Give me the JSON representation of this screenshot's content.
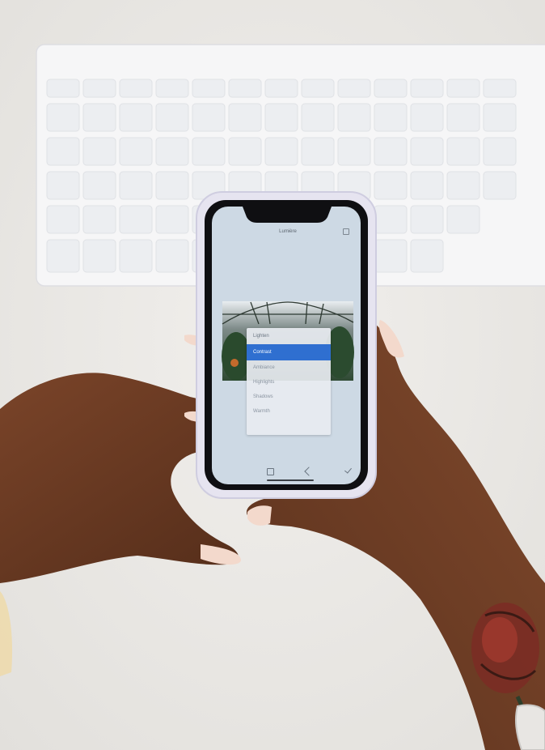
{
  "photo": {
    "subject": "hands holding a smartphone above a white keyboard",
    "colors": {
      "background": "#e9e7e4",
      "keyboard": "#f5f5f6",
      "key": "#eceef0",
      "phone_case": "#e4e2ee",
      "screen": "#c9d6e2",
      "accent": "#2f6fd0",
      "skin": "#6b3a24",
      "nails": "#f2d6c8"
    }
  },
  "phone_ui": {
    "header_title": "Lumière",
    "menu_items": [
      {
        "label": "Lighten",
        "selected": false
      },
      {
        "label": "Contrast",
        "selected": true
      },
      {
        "label": "Ambiance",
        "selected": false
      },
      {
        "label": "Highlights",
        "selected": false
      },
      {
        "label": "Shadows",
        "selected": false
      },
      {
        "label": "Warmth",
        "selected": false
      }
    ],
    "icons": [
      "adjust-icon",
      "brush-icon",
      "check-icon"
    ]
  }
}
